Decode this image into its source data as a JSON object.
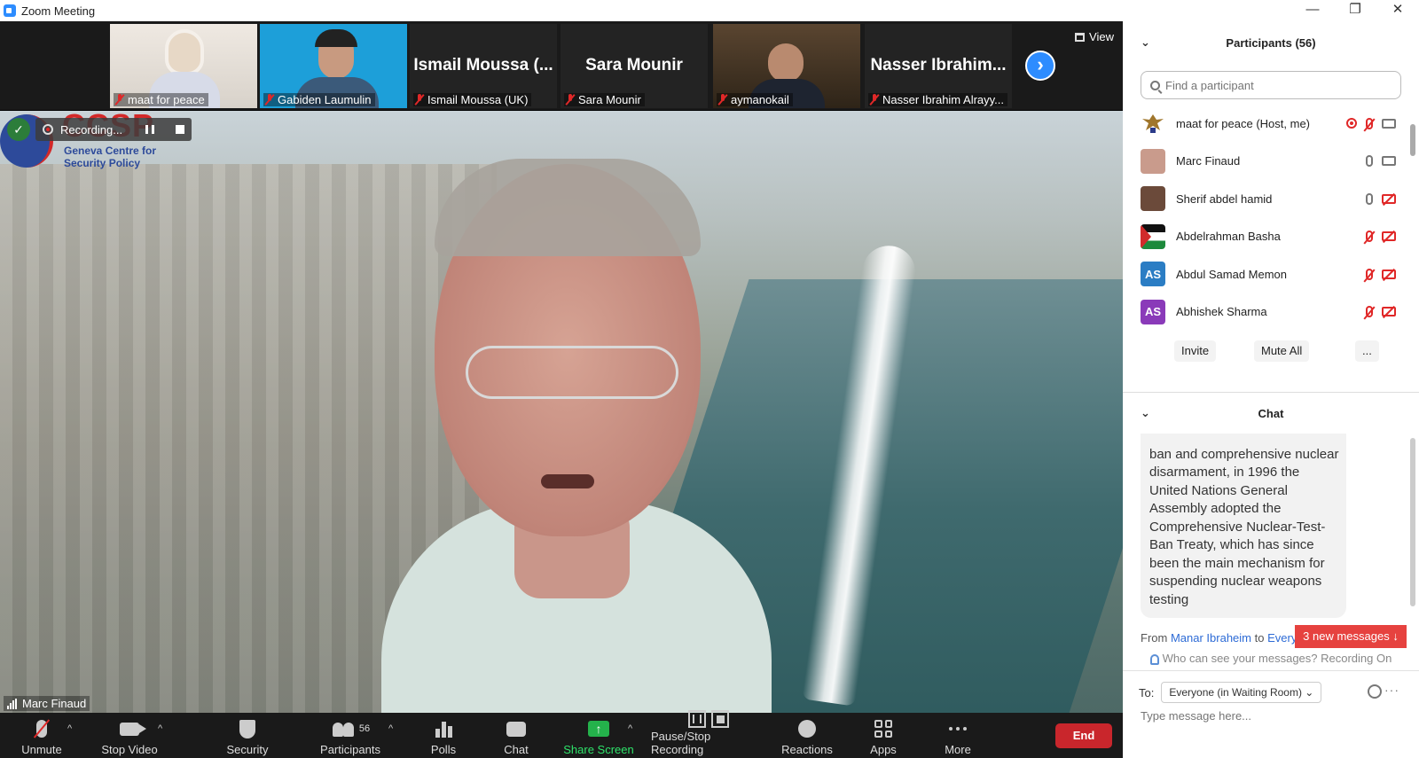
{
  "window": {
    "title": "Zoom Meeting",
    "minimize": "—",
    "maximize": "❐",
    "close": "✕"
  },
  "thumbnails": [
    {
      "name": "maat for peace",
      "type": "video"
    },
    {
      "name": "Gabiden Laumulin",
      "type": "video"
    },
    {
      "name": "Ismail Moussa (UK)",
      "big": "Ismail  Moussa  (...",
      "type": "name"
    },
    {
      "name": "Sara Mounir",
      "big": "Sara Mounir",
      "type": "name"
    },
    {
      "name": "aymanokail",
      "type": "video"
    },
    {
      "name": "Nasser Ibrahim Alrayy...",
      "big": "Nasser  Ibrahim...",
      "type": "name"
    }
  ],
  "view_button": "View",
  "main_video": {
    "speaker": "Marc Finaud",
    "recording_label": "Recording...",
    "logo_text": "CCSP",
    "logo_sub_1": "Geneva Centre for",
    "logo_sub_2": "Security Policy",
    "shield_mark": "✓"
  },
  "toolbar": {
    "unmute": "Unmute",
    "stop_video": "Stop Video",
    "security": "Security",
    "participants": "Participants",
    "participants_count": "56",
    "polls": "Polls",
    "chat": "Chat",
    "share_screen": "Share Screen",
    "share_arrow": "↑",
    "pause_stop": "Pause/Stop Recording",
    "reactions": "Reactions",
    "apps": "Apps",
    "more": "More",
    "end": "End",
    "caret": "^"
  },
  "participants_panel": {
    "title": "Participants (56)",
    "collapse": "⌄",
    "search_placeholder": "Find a participant",
    "list": [
      {
        "name": "maat for peace (Host, me)",
        "initials": "",
        "avatar_color": "#ffffff"
      },
      {
        "name": "Marc Finaud",
        "initials": "",
        "avatar_color": "#c99b8c"
      },
      {
        "name": "Sherif abdel hamid",
        "initials": "",
        "avatar_color": "#6b4a3a"
      },
      {
        "name": "Abdelrahman Basha",
        "initials": "",
        "avatar_color": "#2c2c2c"
      },
      {
        "name": "Abdul Samad Memon",
        "initials": "AS",
        "avatar_color": "#2b7dc4"
      },
      {
        "name": "Abhishek Sharma",
        "initials": "AS",
        "avatar_color": "#8a3ab9"
      }
    ],
    "invite": "Invite",
    "mute_all": "Mute All",
    "more": "..."
  },
  "chat_panel": {
    "title": "Chat",
    "collapse": "⌄",
    "message": "ban and comprehensive nuclear disarmament, in 1996 the United Nations General Assembly adopted the Comprehensive Nuclear-Test-Ban Treaty, which has since been the main mechanism for suspending nuclear weapons testing",
    "from_prefix": "From",
    "from_name": "Manar Ibraheim",
    "to_word": "to",
    "to_name": "Every",
    "new_messages": "3 new messages ↓",
    "who_can_see": "Who can see your messages? Recording On",
    "to_label": "To:",
    "to_value": "Everyone (in Waiting Room) ⌄",
    "more_dots": "···",
    "type_placeholder": "Type message here..."
  }
}
